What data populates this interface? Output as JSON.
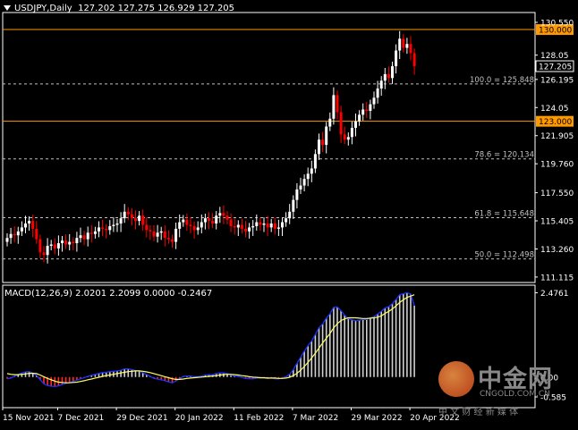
{
  "header": {
    "symbol": "USDJPY,Daily",
    "ohlc": "127.202 127.275 126.929 127.205"
  },
  "macd_header": "MACD(12,26,9) 2.0201 2.2099 0.0000 -0.2467",
  "watermark": {
    "brand": "中金网",
    "site": "CNGOLD.COM.CN",
    "tagline": "中 文 财 经 新 媒 体"
  },
  "price_axis": {
    "min": 110.7,
    "max": 131.3,
    "ticks": [
      "130.550",
      "128.05",
      "126.195",
      "124.05",
      "121.905",
      "119.760",
      "117.550",
      "115.405",
      "113.260",
      "111.115"
    ],
    "tick_values": [
      130.55,
      128.05,
      126.195,
      124.05,
      121.905,
      119.76,
      117.55,
      115.405,
      113.26,
      111.115
    ],
    "current_price": "127.205",
    "current_price_value": 127.205
  },
  "levels": [
    {
      "label": "130.000",
      "value": 130.0,
      "color": "#ff9900"
    },
    {
      "label": "123.000",
      "value": 123.0,
      "color": "#ff9900"
    }
  ],
  "fib_levels": [
    {
      "label": "100.0 = 125.848",
      "value": 125.848
    },
    {
      "label": "78.6 = 120.134",
      "value": 120.134
    },
    {
      "label": "61.8 = 115.648",
      "value": 115.648
    },
    {
      "label": "50.0 = 112.498",
      "value": 112.498
    }
  ],
  "macd_axis": {
    "min": -0.9,
    "max": 2.7,
    "ticks": [
      "2.4761",
      "0.00",
      "-0.585"
    ],
    "tick_values": [
      2.4761,
      0.0,
      -0.585
    ]
  },
  "date_labels": [
    "15 Nov 2021",
    "7 Dec 2021",
    "29 Dec 2021",
    "20 Jan 2022",
    "11 Feb 2022",
    "7 Mar 2022",
    "29 Mar 2022",
    "20 Apr 2022"
  ],
  "date_label_index": [
    0,
    15,
    31,
    47,
    63,
    79,
    95,
    111
  ],
  "colors": {
    "bull": "#ffffff",
    "bear": "#ff0000",
    "grid": "#c0c0c0",
    "macd_main": "#1e32ff",
    "macd_signal": "#ffff66",
    "level": "#ff9900",
    "frame": "#ffffff"
  },
  "chart_data": {
    "type": "candlestick",
    "symbol": "USDJPY",
    "timeframe": "Daily",
    "closes": [
      114.1,
      114.4,
      114.3,
      114.6,
      114.9,
      115.2,
      115.4,
      114.8,
      114.0,
      113.0,
      112.8,
      113.5,
      113.6,
      113.3,
      113.7,
      113.9,
      113.6,
      113.8,
      113.7,
      114.1,
      114.3,
      114.0,
      114.5,
      114.4,
      114.6,
      114.9,
      114.8,
      114.7,
      115.0,
      115.1,
      115.2,
      115.6,
      116.1,
      115.9,
      115.6,
      115.4,
      115.8,
      115.1,
      114.7,
      114.6,
      114.2,
      114.5,
      114.6,
      114.1,
      114.0,
      113.8,
      114.8,
      115.3,
      115.5,
      115.1,
      115.0,
      114.7,
      114.9,
      115.3,
      115.6,
      115.4,
      115.2,
      115.8,
      116.0,
      115.8,
      115.5,
      115.0,
      114.9,
      115.1,
      114.8,
      114.6,
      114.9,
      115.0,
      115.3,
      115.1,
      115.2,
      114.9,
      115.2,
      114.8,
      114.9,
      115.3,
      115.6,
      116.1,
      117.0,
      117.8,
      118.1,
      118.6,
      119.0,
      119.4,
      120.5,
      121.6,
      121.2,
      122.6,
      123.2,
      125.0,
      123.7,
      122.0,
      121.6,
      121.8,
      122.5,
      123.0,
      123.5,
      123.9,
      123.8,
      124.3,
      124.8,
      125.5,
      126.1,
      126.6,
      126.3,
      127.2,
      128.4,
      129.3,
      128.6,
      128.9,
      128.2,
      127.2
    ],
    "macd": [
      -0.05,
      -0.03,
      0.02,
      0.08,
      0.12,
      0.15,
      0.16,
      0.12,
      0.05,
      -0.08,
      -0.2,
      -0.25,
      -0.27,
      -0.28,
      -0.26,
      -0.22,
      -0.19,
      -0.16,
      -0.13,
      -0.09,
      -0.05,
      -0.02,
      0.02,
      0.05,
      0.08,
      0.11,
      0.13,
      0.14,
      0.16,
      0.17,
      0.18,
      0.2,
      0.24,
      0.24,
      0.22,
      0.19,
      0.18,
      0.13,
      0.07,
      0.02,
      -0.04,
      -0.06,
      -0.08,
      -0.11,
      -0.14,
      -0.17,
      -0.12,
      -0.05,
      0.02,
      0.03,
      0.03,
      0.01,
      0.01,
      0.03,
      0.06,
      0.07,
      0.07,
      0.1,
      0.12,
      0.12,
      0.1,
      0.06,
      0.03,
      0.02,
      -0.01,
      -0.04,
      -0.05,
      -0.05,
      -0.03,
      -0.03,
      -0.03,
      -0.04,
      -0.03,
      -0.05,
      -0.05,
      -0.03,
      0.01,
      0.08,
      0.22,
      0.4,
      0.58,
      0.76,
      0.92,
      1.06,
      1.25,
      1.45,
      1.56,
      1.73,
      1.86,
      2.05,
      2.06,
      1.95,
      1.82,
      1.72,
      1.68,
      1.66,
      1.67,
      1.69,
      1.69,
      1.73,
      1.78,
      1.85,
      1.93,
      2.03,
      2.07,
      2.16,
      2.28,
      2.42,
      2.45,
      2.48,
      2.44,
      2.1
    ],
    "signal": [
      0.1,
      0.08,
      0.07,
      0.07,
      0.08,
      0.09,
      0.11,
      0.11,
      0.1,
      0.06,
      0.01,
      -0.04,
      -0.08,
      -0.12,
      -0.15,
      -0.16,
      -0.17,
      -0.17,
      -0.16,
      -0.15,
      -0.13,
      -0.11,
      -0.08,
      -0.06,
      -0.03,
      -0.01,
      0.02,
      0.04,
      0.06,
      0.08,
      0.1,
      0.12,
      0.14,
      0.16,
      0.17,
      0.18,
      0.18,
      0.17,
      0.15,
      0.13,
      0.1,
      0.07,
      0.04,
      0.01,
      -0.02,
      -0.05,
      -0.07,
      -0.07,
      -0.06,
      -0.04,
      -0.03,
      -0.02,
      -0.01,
      0.0,
      0.01,
      0.02,
      0.03,
      0.04,
      0.06,
      0.07,
      0.08,
      0.08,
      0.07,
      0.06,
      0.04,
      0.03,
      0.01,
      0.0,
      -0.01,
      -0.02,
      -0.02,
      -0.03,
      -0.03,
      -0.03,
      -0.04,
      -0.04,
      -0.03,
      -0.01,
      0.04,
      0.11,
      0.2,
      0.31,
      0.43,
      0.56,
      0.7,
      0.85,
      1.0,
      1.14,
      1.28,
      1.44,
      1.57,
      1.66,
      1.71,
      1.74,
      1.74,
      1.74,
      1.73,
      1.72,
      1.72,
      1.73,
      1.74,
      1.76,
      1.8,
      1.87,
      1.93,
      2.0,
      2.09,
      2.19,
      2.27,
      2.34,
      2.38,
      2.42
    ],
    "bull_color": "#ffffff",
    "bear_color": "#ff0000"
  }
}
